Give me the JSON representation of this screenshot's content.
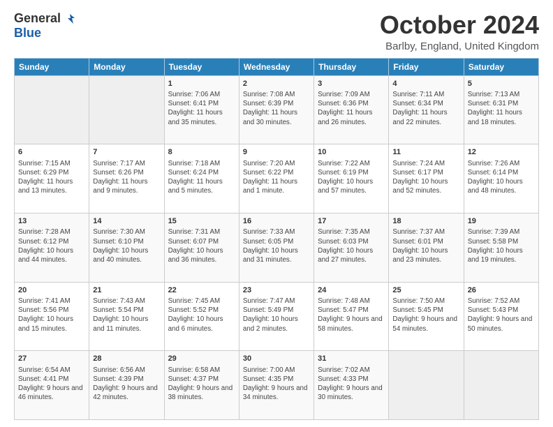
{
  "header": {
    "logo_general": "General",
    "logo_blue": "Blue",
    "month_title": "October 2024",
    "location": "Barlby, England, United Kingdom"
  },
  "columns": [
    "Sunday",
    "Monday",
    "Tuesday",
    "Wednesday",
    "Thursday",
    "Friday",
    "Saturday"
  ],
  "weeks": [
    [
      {
        "day": "",
        "sunrise": "",
        "sunset": "",
        "daylight": ""
      },
      {
        "day": "",
        "sunrise": "",
        "sunset": "",
        "daylight": ""
      },
      {
        "day": "1",
        "sunrise": "Sunrise: 7:06 AM",
        "sunset": "Sunset: 6:41 PM",
        "daylight": "Daylight: 11 hours and 35 minutes."
      },
      {
        "day": "2",
        "sunrise": "Sunrise: 7:08 AM",
        "sunset": "Sunset: 6:39 PM",
        "daylight": "Daylight: 11 hours and 30 minutes."
      },
      {
        "day": "3",
        "sunrise": "Sunrise: 7:09 AM",
        "sunset": "Sunset: 6:36 PM",
        "daylight": "Daylight: 11 hours and 26 minutes."
      },
      {
        "day": "4",
        "sunrise": "Sunrise: 7:11 AM",
        "sunset": "Sunset: 6:34 PM",
        "daylight": "Daylight: 11 hours and 22 minutes."
      },
      {
        "day": "5",
        "sunrise": "Sunrise: 7:13 AM",
        "sunset": "Sunset: 6:31 PM",
        "daylight": "Daylight: 11 hours and 18 minutes."
      }
    ],
    [
      {
        "day": "6",
        "sunrise": "Sunrise: 7:15 AM",
        "sunset": "Sunset: 6:29 PM",
        "daylight": "Daylight: 11 hours and 13 minutes."
      },
      {
        "day": "7",
        "sunrise": "Sunrise: 7:17 AM",
        "sunset": "Sunset: 6:26 PM",
        "daylight": "Daylight: 11 hours and 9 minutes."
      },
      {
        "day": "8",
        "sunrise": "Sunrise: 7:18 AM",
        "sunset": "Sunset: 6:24 PM",
        "daylight": "Daylight: 11 hours and 5 minutes."
      },
      {
        "day": "9",
        "sunrise": "Sunrise: 7:20 AM",
        "sunset": "Sunset: 6:22 PM",
        "daylight": "Daylight: 11 hours and 1 minute."
      },
      {
        "day": "10",
        "sunrise": "Sunrise: 7:22 AM",
        "sunset": "Sunset: 6:19 PM",
        "daylight": "Daylight: 10 hours and 57 minutes."
      },
      {
        "day": "11",
        "sunrise": "Sunrise: 7:24 AM",
        "sunset": "Sunset: 6:17 PM",
        "daylight": "Daylight: 10 hours and 52 minutes."
      },
      {
        "day": "12",
        "sunrise": "Sunrise: 7:26 AM",
        "sunset": "Sunset: 6:14 PM",
        "daylight": "Daylight: 10 hours and 48 minutes."
      }
    ],
    [
      {
        "day": "13",
        "sunrise": "Sunrise: 7:28 AM",
        "sunset": "Sunset: 6:12 PM",
        "daylight": "Daylight: 10 hours and 44 minutes."
      },
      {
        "day": "14",
        "sunrise": "Sunrise: 7:30 AM",
        "sunset": "Sunset: 6:10 PM",
        "daylight": "Daylight: 10 hours and 40 minutes."
      },
      {
        "day": "15",
        "sunrise": "Sunrise: 7:31 AM",
        "sunset": "Sunset: 6:07 PM",
        "daylight": "Daylight: 10 hours and 36 minutes."
      },
      {
        "day": "16",
        "sunrise": "Sunrise: 7:33 AM",
        "sunset": "Sunset: 6:05 PM",
        "daylight": "Daylight: 10 hours and 31 minutes."
      },
      {
        "day": "17",
        "sunrise": "Sunrise: 7:35 AM",
        "sunset": "Sunset: 6:03 PM",
        "daylight": "Daylight: 10 hours and 27 minutes."
      },
      {
        "day": "18",
        "sunrise": "Sunrise: 7:37 AM",
        "sunset": "Sunset: 6:01 PM",
        "daylight": "Daylight: 10 hours and 23 minutes."
      },
      {
        "day": "19",
        "sunrise": "Sunrise: 7:39 AM",
        "sunset": "Sunset: 5:58 PM",
        "daylight": "Daylight: 10 hours and 19 minutes."
      }
    ],
    [
      {
        "day": "20",
        "sunrise": "Sunrise: 7:41 AM",
        "sunset": "Sunset: 5:56 PM",
        "daylight": "Daylight: 10 hours and 15 minutes."
      },
      {
        "day": "21",
        "sunrise": "Sunrise: 7:43 AM",
        "sunset": "Sunset: 5:54 PM",
        "daylight": "Daylight: 10 hours and 11 minutes."
      },
      {
        "day": "22",
        "sunrise": "Sunrise: 7:45 AM",
        "sunset": "Sunset: 5:52 PM",
        "daylight": "Daylight: 10 hours and 6 minutes."
      },
      {
        "day": "23",
        "sunrise": "Sunrise: 7:47 AM",
        "sunset": "Sunset: 5:49 PM",
        "daylight": "Daylight: 10 hours and 2 minutes."
      },
      {
        "day": "24",
        "sunrise": "Sunrise: 7:48 AM",
        "sunset": "Sunset: 5:47 PM",
        "daylight": "Daylight: 9 hours and 58 minutes."
      },
      {
        "day": "25",
        "sunrise": "Sunrise: 7:50 AM",
        "sunset": "Sunset: 5:45 PM",
        "daylight": "Daylight: 9 hours and 54 minutes."
      },
      {
        "day": "26",
        "sunrise": "Sunrise: 7:52 AM",
        "sunset": "Sunset: 5:43 PM",
        "daylight": "Daylight: 9 hours and 50 minutes."
      }
    ],
    [
      {
        "day": "27",
        "sunrise": "Sunrise: 6:54 AM",
        "sunset": "Sunset: 4:41 PM",
        "daylight": "Daylight: 9 hours and 46 minutes."
      },
      {
        "day": "28",
        "sunrise": "Sunrise: 6:56 AM",
        "sunset": "Sunset: 4:39 PM",
        "daylight": "Daylight: 9 hours and 42 minutes."
      },
      {
        "day": "29",
        "sunrise": "Sunrise: 6:58 AM",
        "sunset": "Sunset: 4:37 PM",
        "daylight": "Daylight: 9 hours and 38 minutes."
      },
      {
        "day": "30",
        "sunrise": "Sunrise: 7:00 AM",
        "sunset": "Sunset: 4:35 PM",
        "daylight": "Daylight: 9 hours and 34 minutes."
      },
      {
        "day": "31",
        "sunrise": "Sunrise: 7:02 AM",
        "sunset": "Sunset: 4:33 PM",
        "daylight": "Daylight: 9 hours and 30 minutes."
      },
      {
        "day": "",
        "sunrise": "",
        "sunset": "",
        "daylight": ""
      },
      {
        "day": "",
        "sunrise": "",
        "sunset": "",
        "daylight": ""
      }
    ]
  ]
}
